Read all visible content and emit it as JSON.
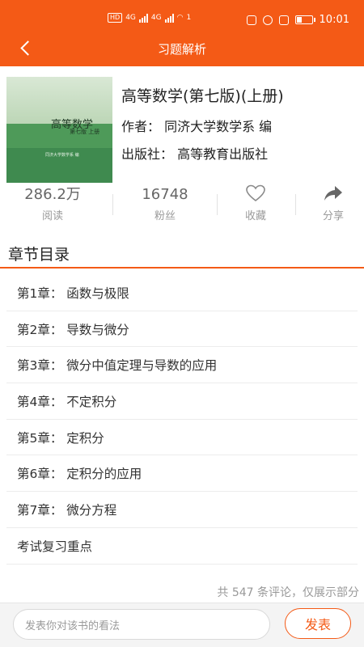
{
  "status_bar": {
    "time": "10:01",
    "network_left": [
      "HD",
      "4G",
      "HD",
      "4G"
    ],
    "wifi_badge": "1"
  },
  "header": {
    "title": "习题解析",
    "back_icon": "chevron-left-icon"
  },
  "book": {
    "title": "高等数学(第七版)(上册)",
    "author": "作者：  同济大学数学系 编",
    "publisher": "出版社：  高等教育出版社",
    "cover": {
      "title": "高等数学",
      "subtitle": "第七版  上册",
      "publisher_line": "同济大学数学系 编",
      "colors": {
        "top": "#d9e8d5",
        "bottom": "#3f8a4f"
      }
    }
  },
  "stats": [
    {
      "value": "286.2万",
      "label": "阅读"
    },
    {
      "value": "16748",
      "label": "粉丝"
    },
    {
      "icon": "heart-icon",
      "label": "收藏"
    },
    {
      "icon": "share-icon",
      "label": "分享"
    }
  ],
  "catalog": {
    "heading": "章节目录",
    "chapters": [
      "第1章：  函数与极限",
      "第2章：  导数与微分",
      "第3章：  微分中值定理与导数的应用",
      "第4章：  不定积分",
      "第5章：  定积分",
      "第6章：  定积分的应用",
      "第7章：  微分方程",
      "考试复习重点"
    ]
  },
  "comments": {
    "note": "共 547 条评论，仅展示部分",
    "input_placeholder": "发表你对该书的看法",
    "post_label": "发表"
  },
  "colors": {
    "accent": "#f45a16"
  }
}
